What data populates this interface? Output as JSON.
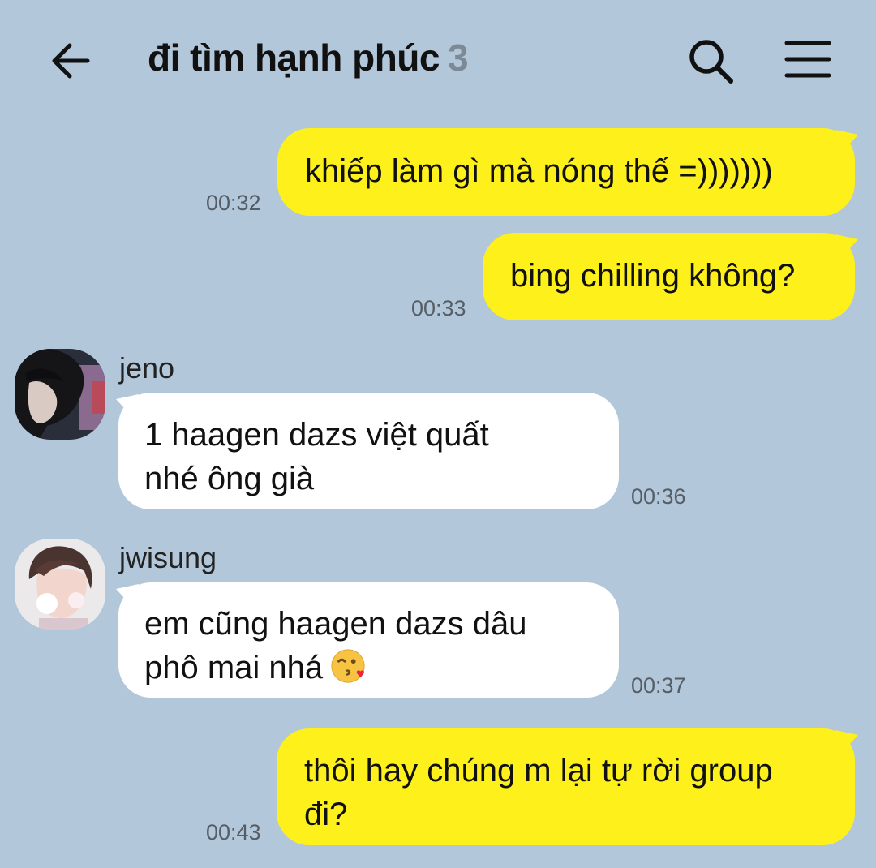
{
  "header": {
    "back_icon": "arrow-left-icon",
    "title": "đi tìm hạnh phúc",
    "member_count": "3",
    "search_icon": "search-icon",
    "menu_icon": "hamburger-menu-icon"
  },
  "colors": {
    "background": "#b2c7da",
    "my_bubble": "#fef01b",
    "other_bubble": "#ffffff",
    "count": "#7d8994"
  },
  "messages": [
    {
      "from": "me",
      "text": "khiếp làm gì mà nóng thế =)))))))",
      "time": "00:32"
    },
    {
      "from": "me",
      "text": "bing chilling không?",
      "time": "00:33"
    },
    {
      "from": "jeno",
      "sender": "jeno",
      "text": "1 haagen dazs việt quất\nnhé ông già",
      "time": "00:36"
    },
    {
      "from": "jwisung",
      "sender": "jwisung",
      "text": "em cũng haagen dazs dâu\nphô mai nhá",
      "emoji": "kissing-wink-emoji",
      "time": "00:37"
    },
    {
      "from": "me",
      "text": "thôi hay chúng m lại tự rời group\nđi?",
      "time": "00:43"
    }
  ]
}
